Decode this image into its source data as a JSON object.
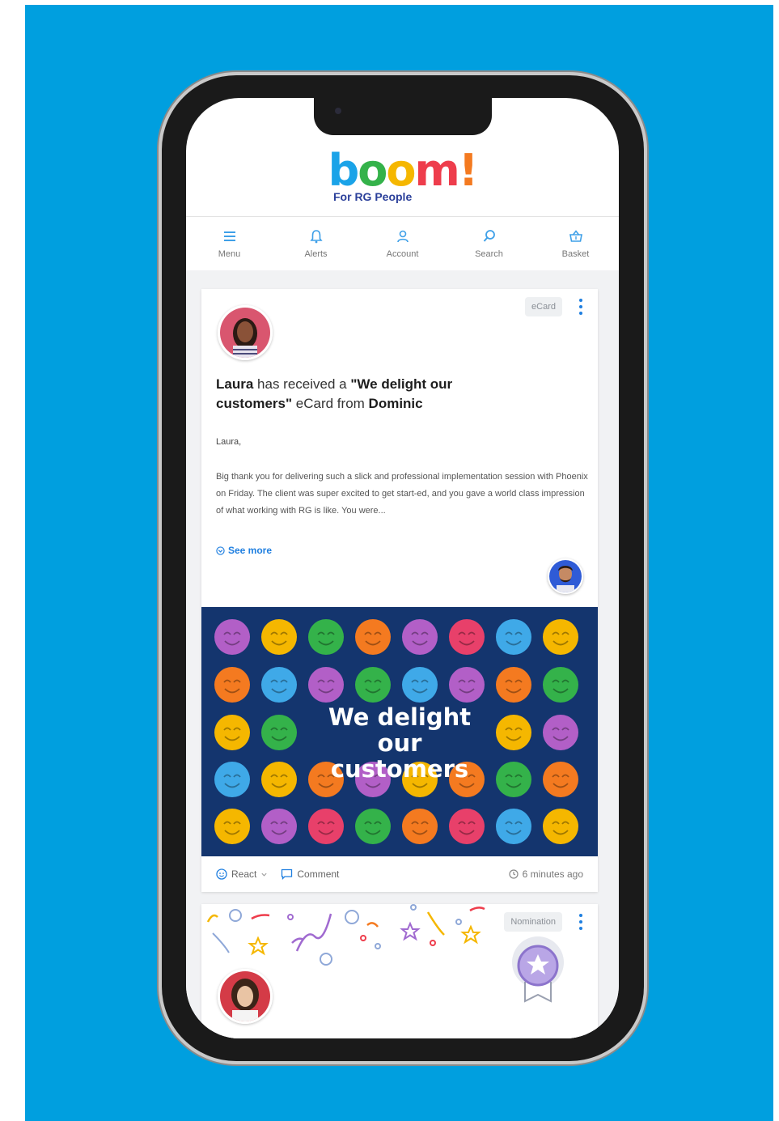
{
  "logo": {
    "letters": [
      "b",
      "o",
      "o",
      "m",
      "!"
    ],
    "tagline": "For RG People"
  },
  "nav": [
    {
      "label": "Menu",
      "icon": "menu-icon"
    },
    {
      "label": "Alerts",
      "icon": "bell-icon"
    },
    {
      "label": "Account",
      "icon": "user-icon"
    },
    {
      "label": "Search",
      "icon": "search-icon"
    },
    {
      "label": "Basket",
      "icon": "basket-icon"
    }
  ],
  "post1": {
    "tag": "eCard",
    "recipient": "Laura",
    "headline_mid": "has received a",
    "card_name": "\"We delight our customers\"",
    "headline_end": "eCard from",
    "sender": "Dominic",
    "salutation": "Laura,",
    "message": "Big thank you for delivering such a slick and professional implementation session with Phoenix on Friday. The client was super excited to get start-ed, and you gave a world class impression of what working with RG is like. You were...",
    "see_more": "See more",
    "ecard_title_line1": "We delight",
    "ecard_title_line2": "our customers",
    "react": "React",
    "comment": "Comment",
    "time": "6 minutes ago"
  },
  "post2": {
    "tag": "Nomination"
  },
  "colors": {
    "background": "#009fdf",
    "accent": "#1f7fe0",
    "ecard_bg": "#14356e",
    "face_colors": [
      "#b25fc7",
      "#f5b700",
      "#34b24a",
      "#f47a20",
      "#e8406a",
      "#3fa9e8"
    ]
  }
}
